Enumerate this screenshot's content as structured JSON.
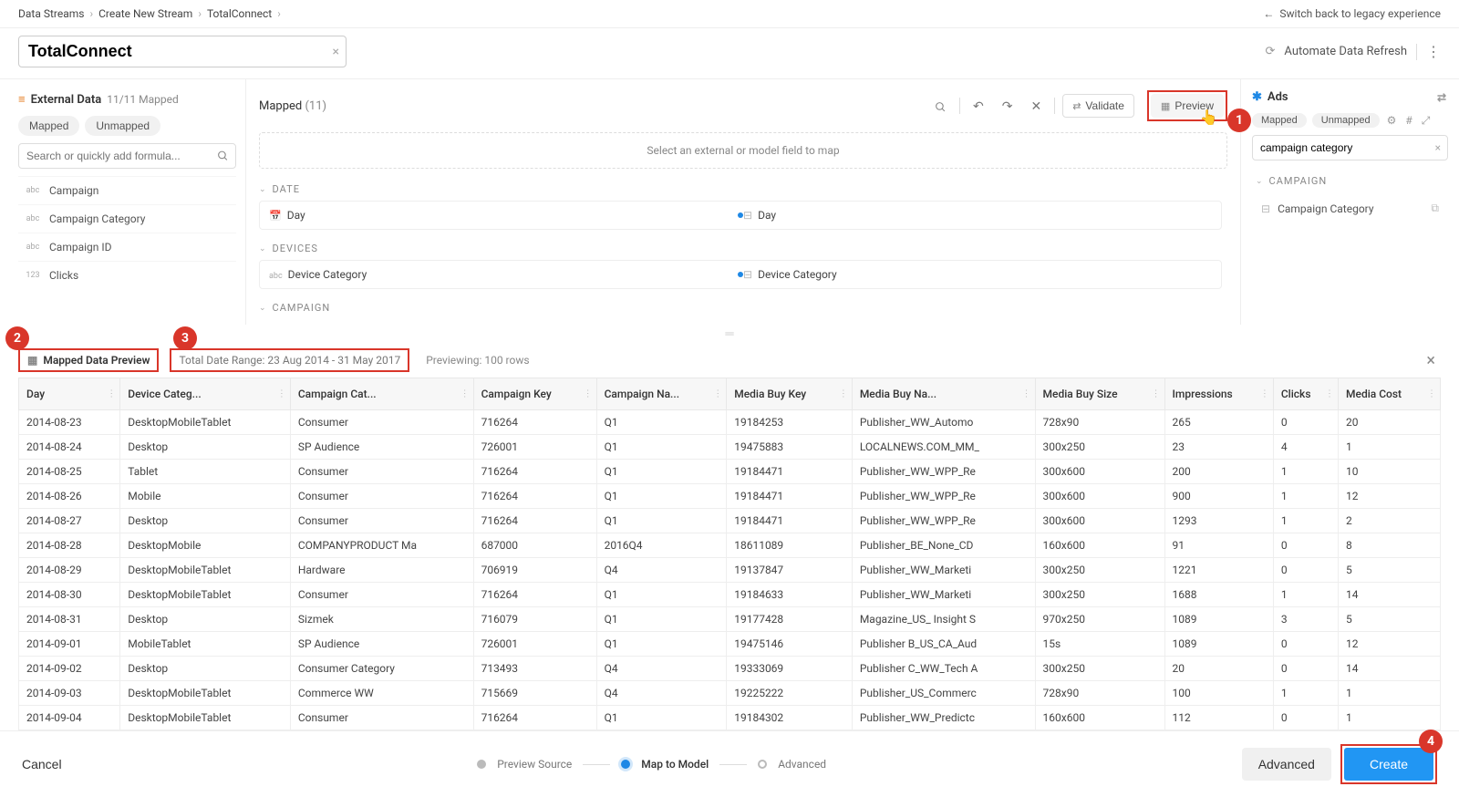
{
  "breadcrumb": [
    "Data Streams",
    "Create New Stream",
    "TotalConnect"
  ],
  "switch_legacy": "Switch back to legacy experience",
  "title": "TotalConnect",
  "automate_label": "Automate Data Refresh",
  "left_panel": {
    "title": "External Data",
    "subtitle": "11/11 Mapped",
    "pills": [
      "Mapped",
      "Unmapped"
    ],
    "search_placeholder": "Search or quickly add formula...",
    "fields": [
      {
        "type": "abc",
        "name": "Campaign"
      },
      {
        "type": "abc",
        "name": "Campaign Category"
      },
      {
        "type": "abc",
        "name": "Campaign ID"
      },
      {
        "type": "123",
        "name": "Clicks"
      }
    ]
  },
  "center": {
    "title": "Mapped",
    "count": "(11)",
    "validate": "Validate",
    "preview": "Preview",
    "banner": "Select an external or model field to map",
    "groups": [
      {
        "label": "DATE",
        "rows": [
          {
            "left_type": "cal",
            "left": "Day",
            "right": "Day"
          }
        ]
      },
      {
        "label": "DEVICES",
        "rows": [
          {
            "left_type": "abc",
            "left": "Device Category",
            "right": "Device Category"
          }
        ]
      },
      {
        "label": "CAMPAIGN",
        "rows": []
      }
    ]
  },
  "right_panel": {
    "title": "Ads",
    "pills": [
      "Mapped",
      "Unmapped"
    ],
    "search_value": "campaign category",
    "group_label": "CAMPAIGN",
    "item": "Campaign Category"
  },
  "preview": {
    "label": "Mapped Data Preview",
    "date_range": "Total Date Range: 23 Aug 2014 - 31 May 2017",
    "row_count": "Previewing: 100 rows",
    "columns": [
      "Day",
      "Device Categ...",
      "Campaign Cat...",
      "Campaign Key",
      "Campaign Na...",
      "Media Buy Key",
      "Media Buy Na...",
      "Media Buy Size",
      "Impressions",
      "Clicks",
      "Media Cost"
    ],
    "rows": [
      [
        "2014-08-23",
        "DesktopMobileTablet",
        "Consumer",
        "716264",
        "Q1",
        "19184253",
        "Publisher_WW_Automo",
        "728x90",
        "265",
        "0",
        "20"
      ],
      [
        "2014-08-24",
        "Desktop",
        "SP Audience",
        "726001",
        "Q1",
        "19475883",
        "LOCALNEWS.COM_MM_",
        "300x250",
        "23",
        "4",
        "1"
      ],
      [
        "2014-08-25",
        "Tablet",
        "Consumer",
        "716264",
        "Q1",
        "19184471",
        "Publisher_WW_WPP_Re",
        "300x600",
        "200",
        "1",
        "10"
      ],
      [
        "2014-08-26",
        "Mobile",
        "Consumer",
        "716264",
        "Q1",
        "19184471",
        "Publisher_WW_WPP_Re",
        "300x600",
        "900",
        "1",
        "12"
      ],
      [
        "2014-08-27",
        "Desktop",
        "Consumer",
        "716264",
        "Q1",
        "19184471",
        "Publisher_WW_WPP_Re",
        "300x600",
        "1293",
        "1",
        "2"
      ],
      [
        "2014-08-28",
        "DesktopMobile",
        "COMPANYPRODUCT Ma",
        "687000",
        "2016Q4",
        "18611089",
        "Publisher_BE_None_CD",
        "160x600",
        "91",
        "0",
        "8"
      ],
      [
        "2014-08-29",
        "DesktopMobileTablet",
        "Hardware",
        "706919",
        "Q4",
        "19137847",
        "Publisher_WW_Marketi",
        "300x250",
        "1221",
        "0",
        "5"
      ],
      [
        "2014-08-30",
        "DesktopMobileTablet",
        "Consumer",
        "716264",
        "Q1",
        "19184633",
        "Publisher_WW_Marketi",
        "300x250",
        "1688",
        "1",
        "14"
      ],
      [
        "2014-08-31",
        "Desktop",
        "Sizmek",
        "716079",
        "Q1",
        "19177428",
        "Magazine_US_ Insight S",
        "970x250",
        "1089",
        "3",
        "5"
      ],
      [
        "2014-09-01",
        "MobileTablet",
        "SP Audience",
        "726001",
        "Q1",
        "19475146",
        "Publisher B_US_CA_Aud",
        "15s",
        "1089",
        "0",
        "12"
      ],
      [
        "2014-09-02",
        "Desktop",
        "Consumer Category",
        "713493",
        "Q4",
        "19333069",
        "Publisher C_WW_Tech A",
        "300x250",
        "20",
        "0",
        "14"
      ],
      [
        "2014-09-03",
        "DesktopMobileTablet",
        "Commerce WW",
        "715669",
        "Q4",
        "19225222",
        "Publisher_US_Commerc",
        "728x90",
        "100",
        "1",
        "1"
      ],
      [
        "2014-09-04",
        "DesktopMobileTablet",
        "Consumer",
        "716264",
        "Q1",
        "19184302",
        "Publisher_WW_Predictc",
        "160x600",
        "112",
        "0",
        "1"
      ]
    ]
  },
  "footer": {
    "cancel": "Cancel",
    "steps": [
      "Preview Source",
      "Map to Model",
      "Advanced"
    ],
    "advanced": "Advanced",
    "create": "Create"
  },
  "callouts": {
    "1": "1",
    "2": "2",
    "3": "3",
    "4": "4"
  }
}
